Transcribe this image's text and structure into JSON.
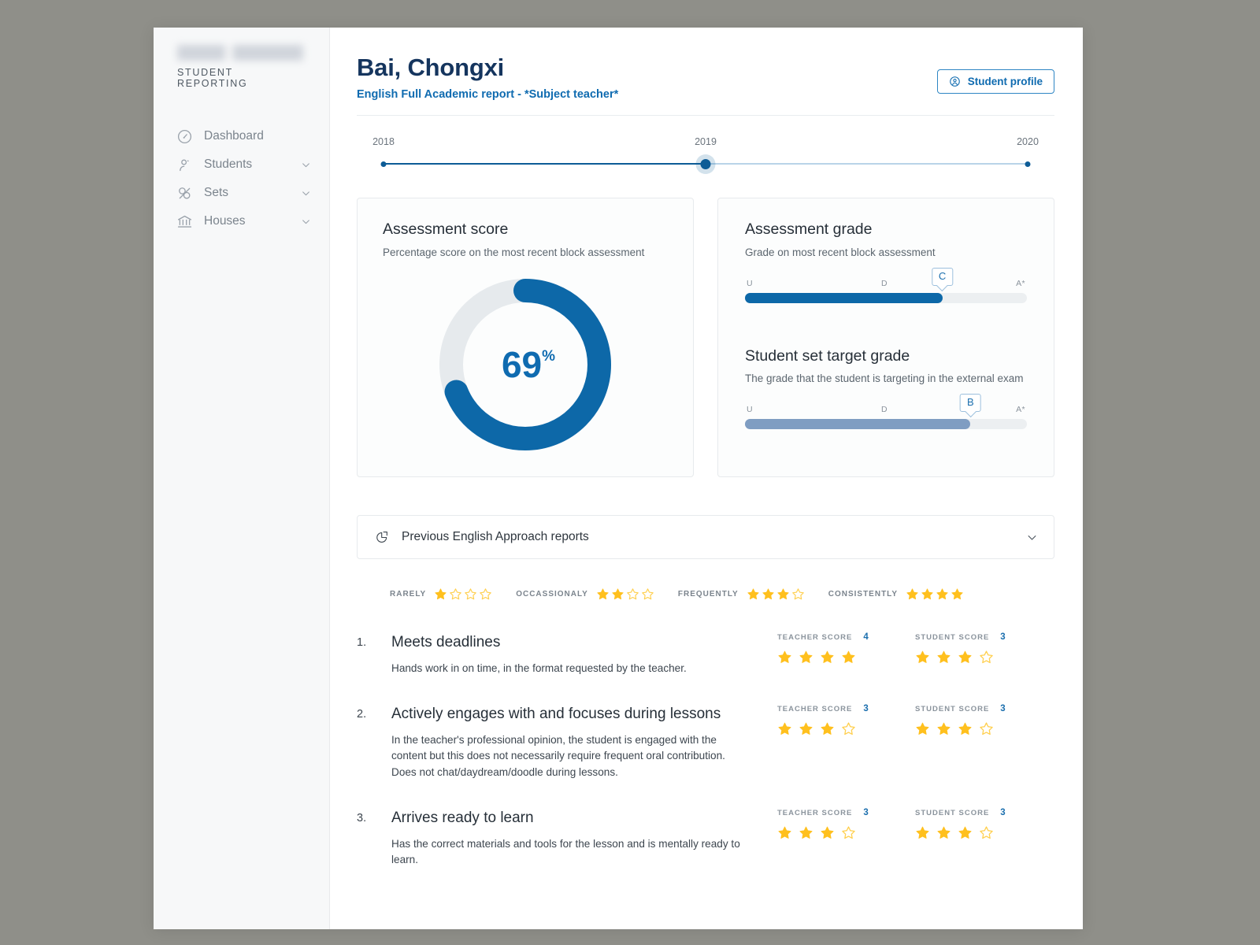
{
  "sidebar": {
    "logo_redacted": true,
    "logo_subtitle": "STUDENT REPORTING",
    "items": [
      {
        "label": "Dashboard",
        "icon": "gauge-icon",
        "expandable": false
      },
      {
        "label": "Students",
        "icon": "users-icon",
        "expandable": true
      },
      {
        "label": "Sets",
        "icon": "sets-icon",
        "expandable": true
      },
      {
        "label": "Houses",
        "icon": "bank-icon",
        "expandable": true
      }
    ]
  },
  "header": {
    "title": "Bai, Chongxi",
    "subtitle": "English Full Academic report - *Subject teacher*",
    "profile_button": "Student profile",
    "profile_button_icon": "user-circle-icon"
  },
  "timeline": {
    "years": [
      "2018",
      "2019",
      "2020"
    ],
    "selected": "2019",
    "selected_index": 1
  },
  "assessment_score": {
    "title": "Assessment score",
    "description": "Percentage score on the most recent block assessment",
    "value": 69,
    "value_display": "69",
    "unit": "%",
    "accent_color": "#0d68a8",
    "track_color": "#e6eaed"
  },
  "assessment_grade": {
    "title": "Assessment grade",
    "description": "Grade on most recent block assessment",
    "ticks": [
      "U",
      "D",
      "A*"
    ],
    "grade": "C",
    "fill_percent": 70,
    "fill_color": "#0d68a8"
  },
  "target_grade": {
    "title": "Student set target grade",
    "description": "The grade that the student is targeting in the external exam",
    "ticks": [
      "U",
      "D",
      "A*"
    ],
    "grade": "B",
    "fill_percent": 80,
    "fill_color": "#7f9dc2"
  },
  "accordion": {
    "label": "Previous English Approach reports",
    "icon": "pie-report-icon",
    "chevron": "chevron-down-icon",
    "expanded": false
  },
  "legend": {
    "max_stars": 4,
    "items": [
      {
        "label": "RARELY",
        "stars": 1
      },
      {
        "label": "OCCASSIONALY",
        "stars": 2
      },
      {
        "label": "FREQUENTLY",
        "stars": 3
      },
      {
        "label": "CONSISTENTLY",
        "stars": 4
      }
    ]
  },
  "criteria": {
    "max_stars": 4,
    "teacher_label": "TEACHER SCORE",
    "student_label": "STUDENT SCORE",
    "items": [
      {
        "number": "1.",
        "title": "Meets deadlines",
        "description": "Hands work in on time, in the format requested by the teacher.",
        "teacher_score": 4,
        "student_score": 3
      },
      {
        "number": "2.",
        "title": "Actively engages with and focuses during lessons",
        "description": "In the teacher's professional opinion, the student is engaged with the content but this does not necessarily require frequent oral contribution. Does not chat/daydream/doodle during lessons.",
        "teacher_score": 3,
        "student_score": 3
      },
      {
        "number": "3.",
        "title": "Arrives ready to learn",
        "description": "Has the correct materials and tools for the lesson and is mentally ready to learn.",
        "teacher_score": 3,
        "student_score": 3
      }
    ]
  },
  "colors": {
    "brand_blue": "#0f6bb0",
    "dark_blue": "#15355e",
    "star_gold": "#ffc01e",
    "star_empty": "#ffcf4d"
  }
}
